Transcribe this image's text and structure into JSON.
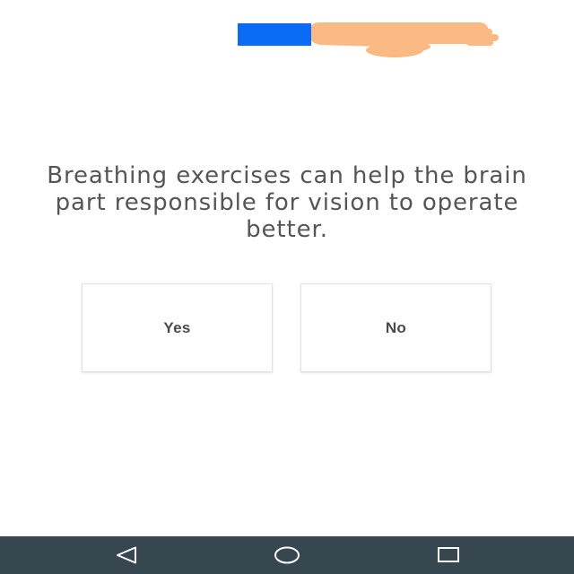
{
  "question": {
    "text": "Breathing exercises can help the brain part responsible for vision to operate better."
  },
  "answers": [
    {
      "label": "Yes"
    },
    {
      "label": "No"
    }
  ],
  "illustration": {
    "icon": "pointing-hand-icon",
    "colors": {
      "sleeve": "#0a6cf5",
      "skin": "#fbb983"
    }
  },
  "nav_bar": {
    "background": "#37474f",
    "icons": [
      "back-icon",
      "home-icon",
      "recents-icon"
    ]
  }
}
